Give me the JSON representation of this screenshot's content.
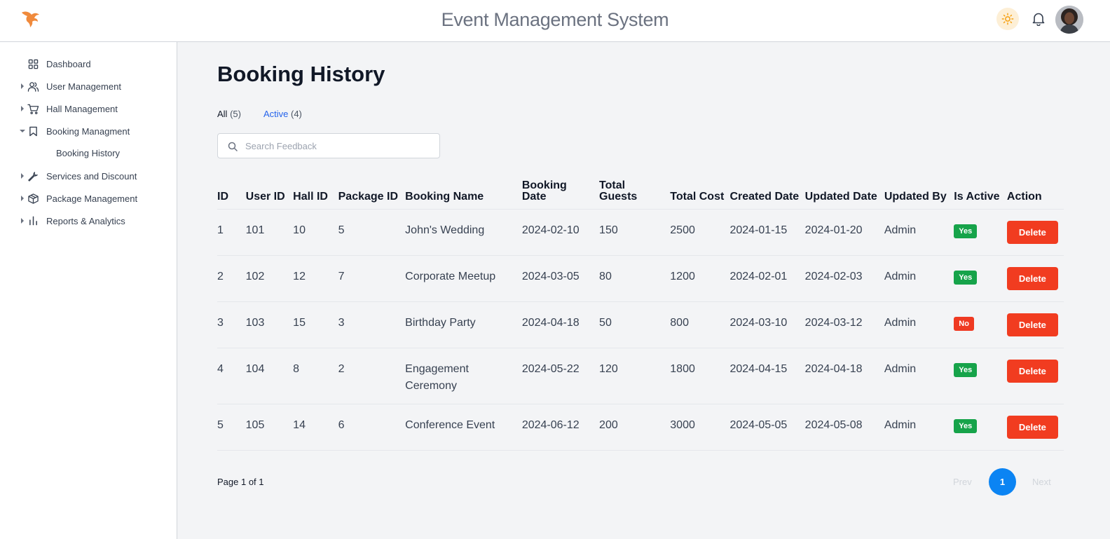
{
  "header": {
    "app_title": "Event Management System",
    "accent_color": "#f08a3c"
  },
  "sidebar": {
    "items": [
      {
        "label": "Dashboard",
        "icon": "grid-icon"
      },
      {
        "label": "User Management",
        "icon": "users-icon"
      },
      {
        "label": "Hall Management",
        "icon": "cart-icon"
      },
      {
        "label": "Booking Managment",
        "icon": "bookmark-icon",
        "expanded": true
      },
      {
        "label": "Booking History",
        "sub": true
      },
      {
        "label": "Services and Discount",
        "icon": "wrench-icon"
      },
      {
        "label": "Package Management",
        "icon": "package-icon"
      },
      {
        "label": "Reports & Analytics",
        "icon": "bar-chart-icon"
      }
    ]
  },
  "main": {
    "title": "Booking History",
    "tabs": [
      {
        "label": "All",
        "count": "(5)"
      },
      {
        "label": "Active",
        "count": "(4)"
      }
    ],
    "search_placeholder": "Search Feedback",
    "columns": [
      "ID",
      "User ID",
      "Hall ID",
      "Package ID",
      "Booking Name",
      "Booking Date",
      "Total Guests",
      "Total Cost",
      "Created Date",
      "Updated Date",
      "Updated By",
      "Is Active",
      "Action"
    ],
    "rows": [
      {
        "id": "1",
        "user_id": "101",
        "hall_id": "10",
        "package_id": "5",
        "name": "John's Wedding",
        "booking_date": "2024-02-10",
        "guests": "150",
        "cost": "2500",
        "created": "2024-01-15",
        "updated": "2024-01-20",
        "updated_by": "Admin",
        "active": "Yes",
        "action": "Delete"
      },
      {
        "id": "2",
        "user_id": "102",
        "hall_id": "12",
        "package_id": "7",
        "name": "Corporate Meetup",
        "booking_date": "2024-03-05",
        "guests": "80",
        "cost": "1200",
        "created": "2024-02-01",
        "updated": "2024-02-03",
        "updated_by": "Admin",
        "active": "Yes",
        "action": "Delete"
      },
      {
        "id": "3",
        "user_id": "103",
        "hall_id": "15",
        "package_id": "3",
        "name": "Birthday Party",
        "booking_date": "2024-04-18",
        "guests": "50",
        "cost": "800",
        "created": "2024-03-10",
        "updated": "2024-03-12",
        "updated_by": "Admin",
        "active": "No",
        "action": "Delete"
      },
      {
        "id": "4",
        "user_id": "104",
        "hall_id": "8",
        "package_id": "2",
        "name": "Engagement Ceremony",
        "booking_date": "2024-05-22",
        "guests": "120",
        "cost": "1800",
        "created": "2024-04-15",
        "updated": "2024-04-18",
        "updated_by": "Admin",
        "active": "Yes",
        "action": "Delete"
      },
      {
        "id": "5",
        "user_id": "105",
        "hall_id": "14",
        "package_id": "6",
        "name": "Conference Event",
        "booking_date": "2024-06-12",
        "guests": "200",
        "cost": "3000",
        "created": "2024-05-05",
        "updated": "2024-05-08",
        "updated_by": "Admin",
        "active": "Yes",
        "action": "Delete"
      }
    ],
    "pagination": {
      "info": "Page 1 of 1",
      "prev": "Prev",
      "current": "1",
      "next": "Next"
    }
  }
}
